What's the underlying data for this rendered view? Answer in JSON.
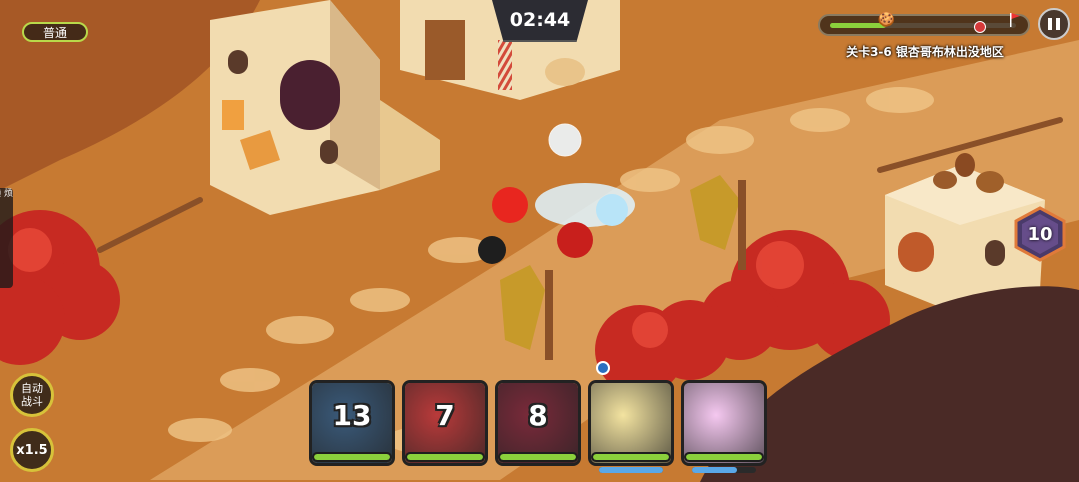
{
  "hud": {
    "difficulty": "普通",
    "timer": "02:44",
    "stage_title": "关卡3-6 银杏哥布林出没地区",
    "stage_progress": 0.3,
    "side_tab_chars": [
      "烦",
      "懒",
      "玑",
      "现",
      "顷",
      "l",
      "引"
    ],
    "auto_battle_label": "自动\n战斗",
    "speed_label": "x1.5",
    "counter_value": "10",
    "pause_icon": "pause-icon"
  },
  "cards": [
    {
      "name": "dark-cookie",
      "cooldown": "13",
      "hp": 1.0,
      "theme": "#3a5a7a"
    },
    {
      "name": "strawberry-cookie",
      "cooldown": "7",
      "hp": 1.0,
      "theme": "#b93a3a"
    },
    {
      "name": "rose-cookie",
      "cooldown": "8",
      "hp": 1.0,
      "theme": "#7a2a3a"
    },
    {
      "name": "golden-cookie",
      "cooldown": "",
      "hp": 1.0,
      "theme": "#f3e3a0",
      "sub": 1.0
    },
    {
      "name": "pink-cookie",
      "cooldown": "",
      "hp": 1.0,
      "theme": "#f5c8f0",
      "sub": 0.7
    }
  ],
  "colors": {
    "ground": "#c9782f",
    "path": "#e8b673",
    "tree_red": "#c72a22",
    "hp_green": "#8bd03c",
    "accent_yellow": "#d7c23a"
  }
}
